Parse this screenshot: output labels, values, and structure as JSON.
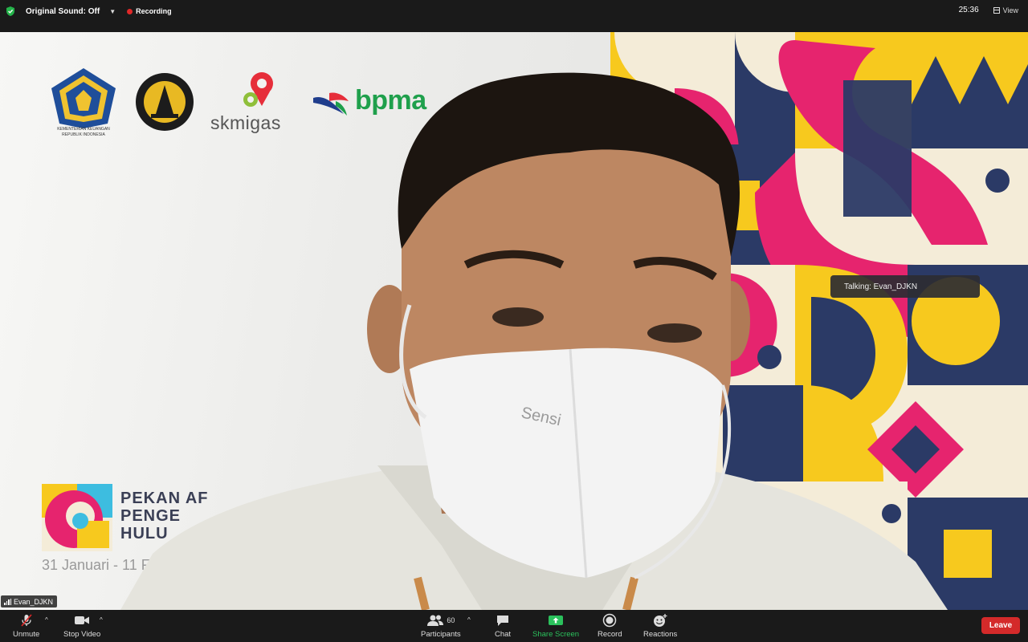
{
  "topbar": {
    "original_sound_label": "Original Sound: Off",
    "recording_label": "Recording",
    "timer": "25:36",
    "view_label": "View"
  },
  "video": {
    "background_logos": {
      "kemenkeu_caption_1": "KEMENTERIAN KEUANGAN",
      "kemenkeu_caption_2": "REPUBLIK INDONESIA",
      "skmigas": "skmigas",
      "bpma": "bpma"
    },
    "event": {
      "title_line1": "PEKAN AF",
      "title_line2": "PENGE",
      "title_line3": "HULU",
      "date": "31 Januari - 11 F"
    },
    "mask_brand": "Sensi",
    "talking_indicator": "Talking: Evan_DJKN",
    "participant_name": "Evan_DJKN"
  },
  "toolbar": {
    "unmute_label": "Unmute",
    "stop_video_label": "Stop Video",
    "participants_label": "Participants",
    "participants_count": "60",
    "chat_label": "Chat",
    "share_screen_label": "Share Screen",
    "record_label": "Record",
    "reactions_label": "Reactions",
    "leave_label": "Leave"
  },
  "colors": {
    "topbar_bg": "#1a1a1a",
    "recording_dot": "#e02828",
    "share_screen_green": "#2bc15c",
    "leave_red": "#d42a2a",
    "bpma_green": "#1fa04c",
    "pattern_navy": "#2b3a66",
    "pattern_pink": "#e6246e",
    "pattern_yellow": "#f7c91e",
    "pattern_cream": "#f4ecd8"
  }
}
